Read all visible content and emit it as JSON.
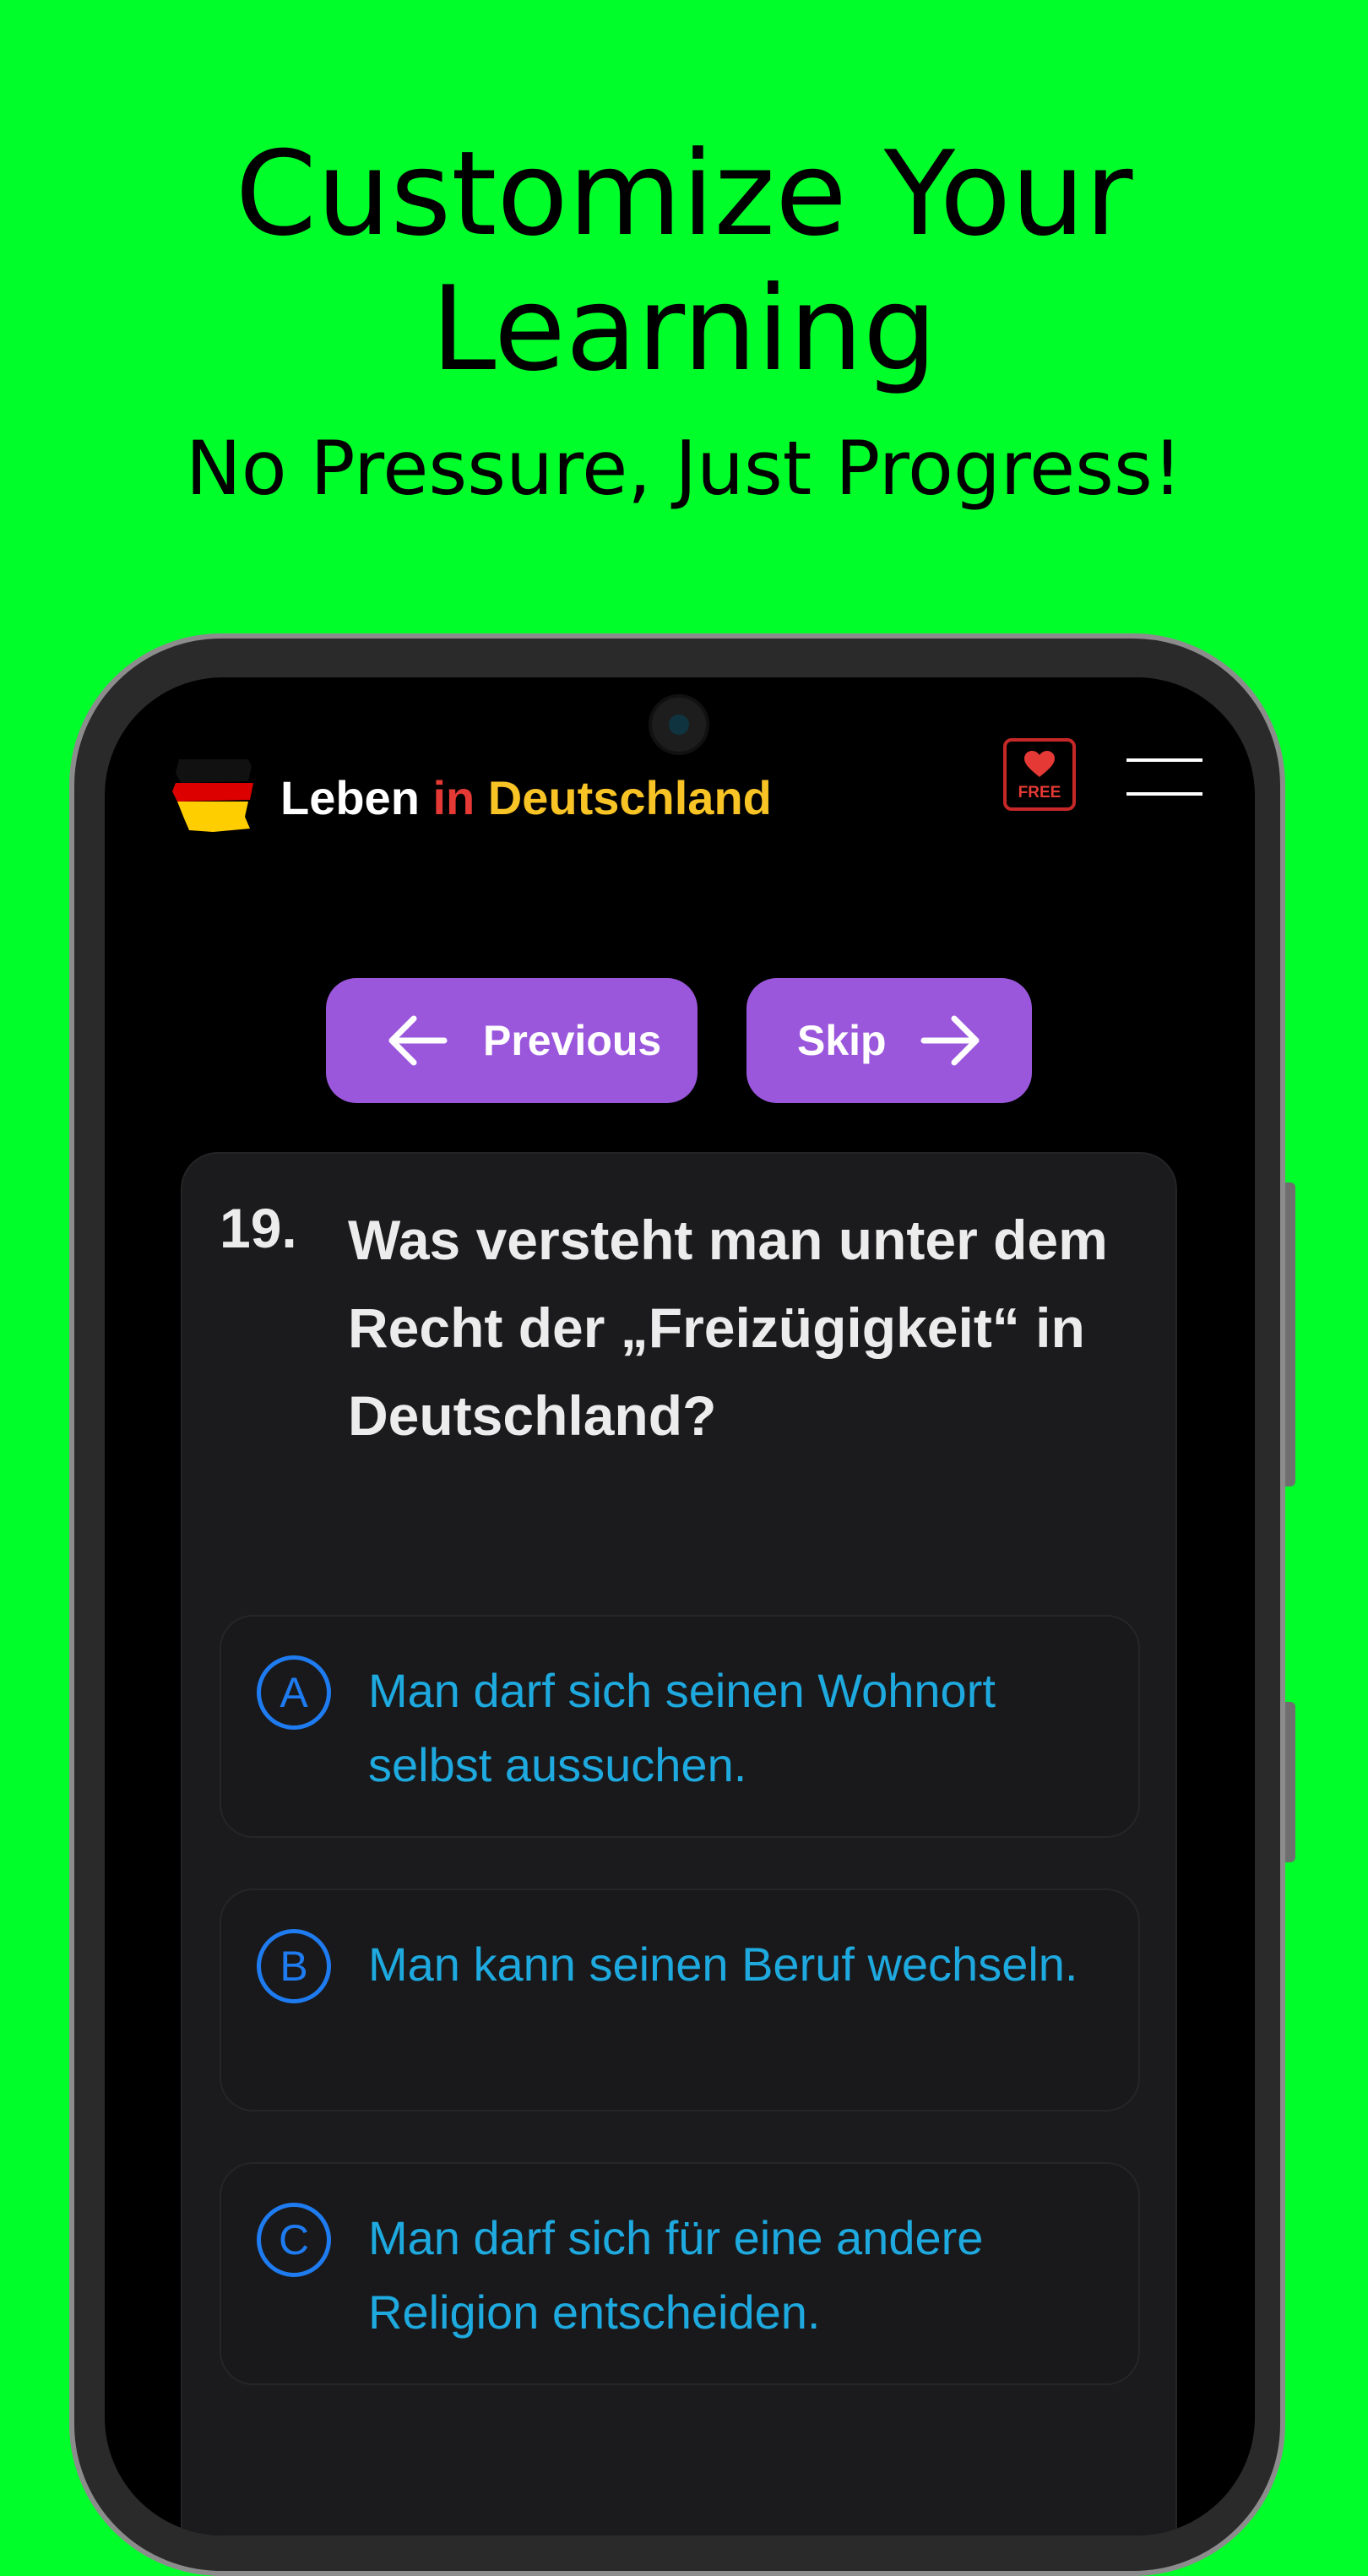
{
  "promo": {
    "title_line1": "Customize Your",
    "title_line2": "Learning",
    "subtitle": "No Pressure, Just Progress!"
  },
  "header": {
    "title_part1": "Leben ",
    "title_part2": "in ",
    "title_part3": "Deutschland",
    "free_badge": "FREE",
    "icons": [
      "germany-flag-icon",
      "heart-icon",
      "menu-icon"
    ]
  },
  "navigation": {
    "previous_label": "Previous",
    "skip_label": "Skip"
  },
  "question": {
    "number": "19.",
    "text": "Was versteht man unter dem Recht der „Freizügigkeit“ in Deutschland?",
    "answers": [
      {
        "letter": "A",
        "text": "Man darf sich seinen Wohnort selbst aussuchen."
      },
      {
        "letter": "B",
        "text": "Man kann seinen Beruf wechseln."
      },
      {
        "letter": "C",
        "text": "Man darf sich für eine andere Religion entscheiden."
      }
    ]
  },
  "colors": {
    "background": "#00ff2a",
    "accent_purple": "#9b57dc",
    "answer_text": "#1ea9df",
    "answer_letter": "#1e7bf0",
    "title_red": "#e53935",
    "title_gold": "#f7c325"
  }
}
